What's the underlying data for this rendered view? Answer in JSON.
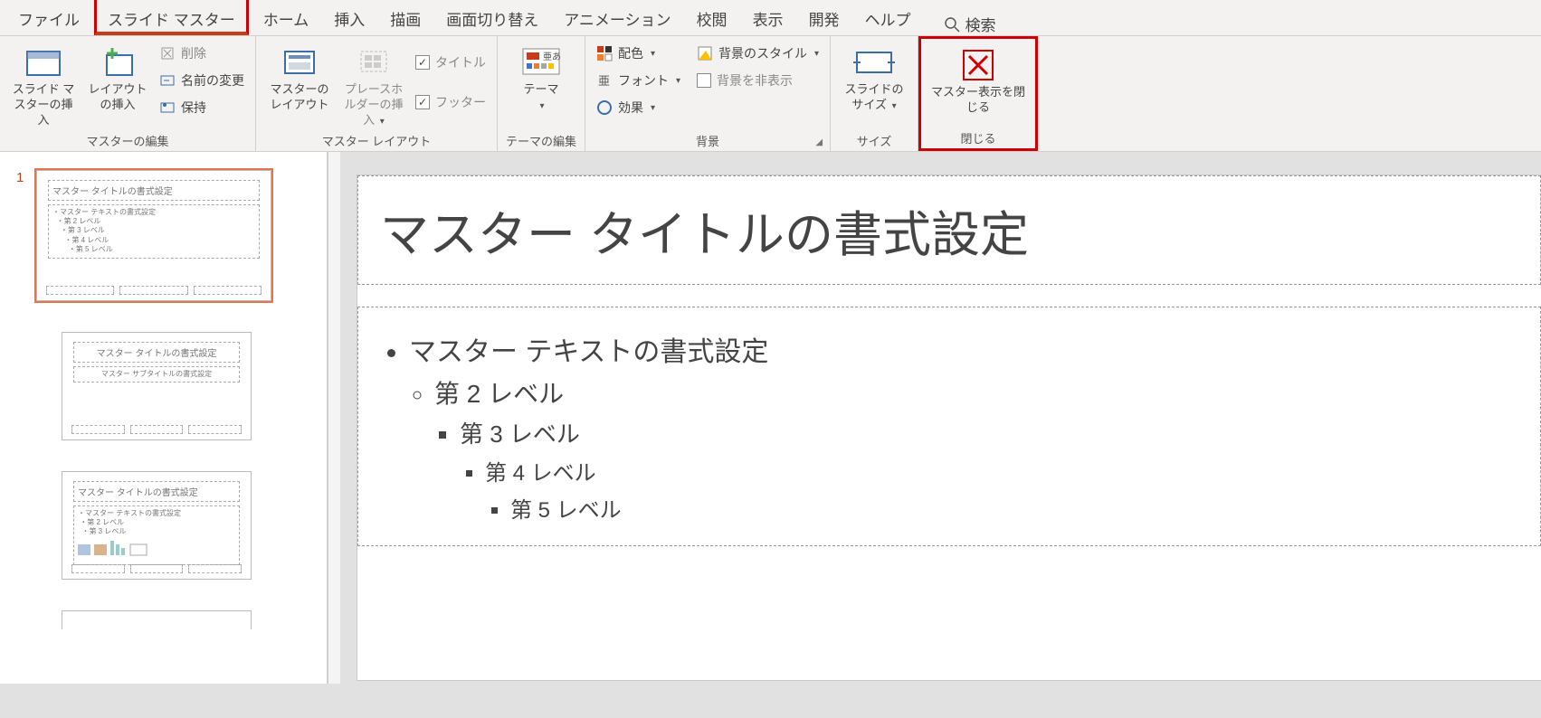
{
  "tabs": {
    "file": "ファイル",
    "slide_master": "スライド マスター",
    "home": "ホーム",
    "insert": "挿入",
    "draw": "描画",
    "transition": "画面切り替え",
    "animation": "アニメーション",
    "review": "校閲",
    "view": "表示",
    "developer": "開発",
    "help": "ヘルプ"
  },
  "search": {
    "placeholder": "検索"
  },
  "ribbon": {
    "g1": {
      "label": "マスターの編集",
      "insert_master": "スライド マスターの挿入",
      "insert_layout": "レイアウトの挿入",
      "delete": "削除",
      "rename": "名前の変更",
      "preserve": "保持"
    },
    "g2": {
      "label": "マスター レイアウト",
      "master_layout": "マスターのレイアウト",
      "insert_placeholder": "プレースホルダーの挿入",
      "title_cb": "タイトル",
      "footer_cb": "フッター"
    },
    "g3": {
      "label": "テーマの編集",
      "themes": "テーマ"
    },
    "g4": {
      "label": "背景",
      "colors": "配色",
      "fonts": "フォント",
      "effects": "効果",
      "bg_styles": "背景のスタイル",
      "hide_bg": "背景を非表示"
    },
    "g5": {
      "label": "サイズ",
      "slide_size": "スライドのサイズ"
    },
    "g6": {
      "label": "閉じる",
      "close_master": "マスター表示を閉じる"
    }
  },
  "thumbs": {
    "index": "1",
    "t1": {
      "title": "マスター タイトルの書式設定",
      "body": "・マスター テキストの書式設定",
      "l2": "・第 2 レベル",
      "l3": "・第 3 レベル",
      "l4": "・第 4 レベル",
      "l5": "・第 5 レベル"
    },
    "t2": {
      "title": "マスター タイトルの書式設定",
      "sub": "マスター サブタイトルの書式設定"
    },
    "t3": {
      "title": "マスター タイトルの書式設定",
      "body": "・マスター テキストの書式設定",
      "l2": "・第 2 レベル",
      "l3": "・第 3 レベル"
    }
  },
  "slide": {
    "title": "マスター タイトルの書式設定",
    "l1": "マスター テキストの書式設定",
    "l2": "第 2 レベル",
    "l3": "第 3 レベル",
    "l4": "第 4 レベル",
    "l5": "第 5 レベル"
  }
}
